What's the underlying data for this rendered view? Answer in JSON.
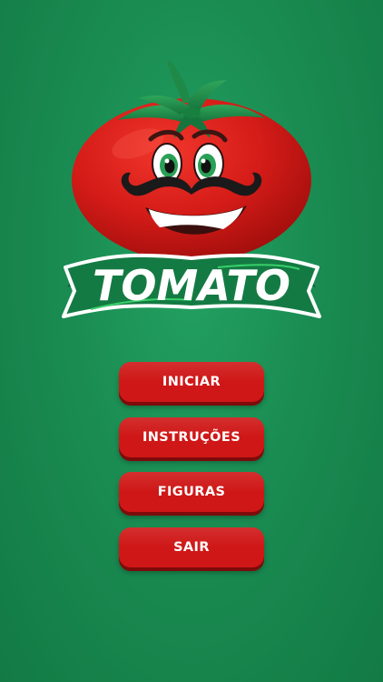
{
  "logo": {
    "title": "TOMATO"
  },
  "menu": {
    "items": [
      {
        "label": "INICIAR"
      },
      {
        "label": "INSTRUÇÕES"
      },
      {
        "label": "FIGURAS"
      },
      {
        "label": "SAIR"
      }
    ]
  },
  "colors": {
    "background": "#1a8c52",
    "tomato_red": "#d61c18",
    "button_red": "#cf1717",
    "banner_green": "#147a43",
    "text_white": "#ffffff"
  },
  "icons": [
    "tomato-mascot-icon",
    "mustache-icon"
  ]
}
